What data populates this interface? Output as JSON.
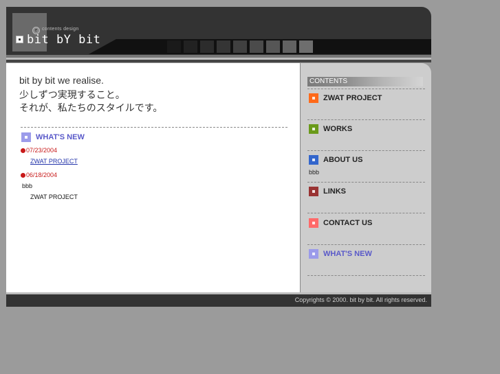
{
  "header": {
    "logo_text": "bit bY bit",
    "logo_sub": "contents design",
    "logo_badge": "e",
    "stripe_colors": [
      "#111111",
      "#1a1a1a",
      "#222222",
      "#2c2c2c",
      "#353535",
      "#404040",
      "#4b4b4b",
      "#565656",
      "#626262",
      "#6e6e6e"
    ]
  },
  "main": {
    "tagline": [
      "bit by bit we realise.",
      "少しずつ実現すること。",
      "それが、私たちのスタイルです。"
    ],
    "news_heading": "WHAT'S NEW",
    "news": [
      {
        "date": "07/23/2004",
        "link": "ZWAT PROJECT"
      },
      {
        "date": "06/18/2004",
        "text1": "bbb",
        "text2": "ZWAT PROJECT"
      }
    ]
  },
  "sidebar": {
    "contents_label": "CONTENTS",
    "items": [
      {
        "label": "ZWAT PROJECT",
        "color": "#ff6a1a"
      },
      {
        "label": "WORKS",
        "color": "#6a9a1a"
      },
      {
        "label": "ABOUT US",
        "color": "#3366cc",
        "sub": "bbb"
      },
      {
        "label": "LINKS",
        "color": "#993333"
      },
      {
        "label": "CONTACT US",
        "color": "#ff6a6a"
      },
      {
        "label": "WHAT'S NEW",
        "color": "#9b9bea",
        "label_color": "#5959c9"
      }
    ]
  },
  "footer": {
    "copyright": "Copyrights © 2000. bit by bit. All rights reserved."
  }
}
